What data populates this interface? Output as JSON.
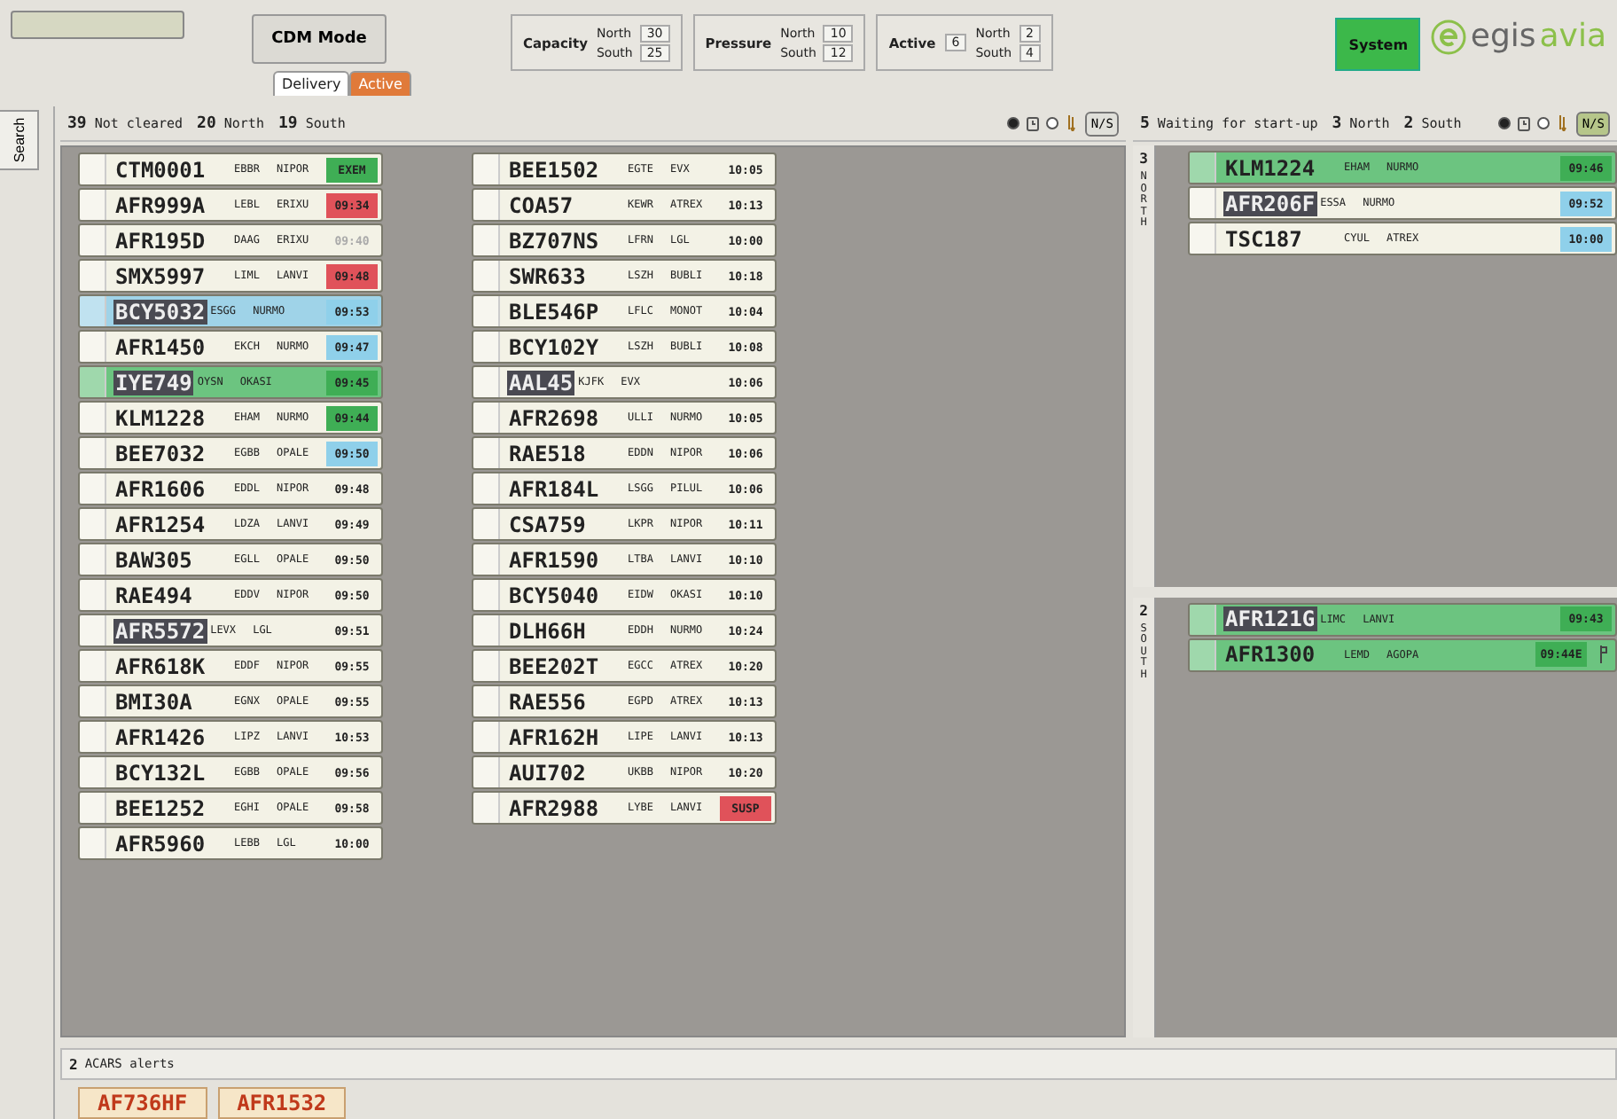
{
  "search_tab": {
    "label": "Search"
  },
  "top": {
    "mode_button": "CDM Mode",
    "tabs": [
      {
        "label": "Delivery",
        "selected": true
      },
      {
        "label": "Active",
        "selected": false
      }
    ],
    "gauges": [
      {
        "label": "Capacity",
        "north_label": "North",
        "north": "30",
        "south_label": "South",
        "south": "25"
      },
      {
        "label": "Pressure",
        "north_label": "North",
        "north": "10",
        "south_label": "South",
        "south": "12"
      },
      {
        "label": "Active",
        "total": "6",
        "north_label": "North",
        "north": "2",
        "south_label": "South",
        "south": "4"
      }
    ],
    "system_button": "System",
    "logo": {
      "name": "egis",
      "suffix": "avia"
    }
  },
  "left_panel": {
    "counts": [
      "**39** Not cleared",
      "**20** North",
      "**19** South"
    ],
    "sort_options": [
      {
        "kind": "time",
        "selected": true
      },
      {
        "kind": "order",
        "selected": false
      }
    ],
    "ns_button": {
      "label": "N/S",
      "on": false
    },
    "columns": [
      [
        {
          "callsign": "CTM0001",
          "adep": "EBBR",
          "point": "NIPOR",
          "time": {
            "text": "EXEM",
            "color": "#3fae55",
            "dimmed": false
          },
          "color": "#f3f2e6",
          "selected": false
        },
        {
          "callsign": "AFR999A",
          "adep": "LEBL",
          "point": "ERIXU",
          "time": {
            "text": "09:34",
            "color": "#e0525a",
            "dimmed": false
          },
          "color": "#f3f2e6",
          "selected": false
        },
        {
          "callsign": "AFR195D",
          "adep": "DAAG",
          "point": "ERIXU",
          "time": {
            "text": "09:40",
            "dimmed": true
          },
          "color": "#f3f2e6",
          "selected": false
        },
        {
          "callsign": "SMX5997",
          "adep": "LIML",
          "point": "LANVI",
          "time": {
            "text": "09:48",
            "color": "#e0525a",
            "dimmed": false
          },
          "color": "#f3f2e6",
          "selected": false
        },
        {
          "callsign": "BCY5032",
          "adep": "ESGG",
          "point": "NURMO",
          "time": {
            "text": "09:53",
            "color": "#8fd0ea",
            "dimmed": false
          },
          "color": "#9fd3e8",
          "selected": true
        },
        {
          "callsign": "AFR1450",
          "adep": "EKCH",
          "point": "NURMO",
          "time": {
            "text": "09:47",
            "color": "#8fd0ea",
            "dimmed": false
          },
          "color": "#f3f2e6",
          "selected": false
        },
        {
          "callsign": "IYE749",
          "adep": "OYSN",
          "point": "OKASI",
          "time": {
            "text": "09:45",
            "color": "#3fae55",
            "dimmed": false
          },
          "color": "#6cc480",
          "selected": true
        },
        {
          "callsign": "KLM1228",
          "adep": "EHAM",
          "point": "NURMO",
          "time": {
            "text": "09:44",
            "color": "#3fae55",
            "dimmed": false
          },
          "color": "#f3f2e6",
          "selected": false
        },
        {
          "callsign": "BEE7032",
          "adep": "EGBB",
          "point": "OPALE",
          "time": {
            "text": "09:50",
            "color": "#8fd0ea",
            "dimmed": false
          },
          "color": "#f3f2e6",
          "selected": false
        },
        {
          "callsign": "AFR1606",
          "adep": "EDDL",
          "point": "NIPOR",
          "time": {
            "text": "09:48",
            "dimmed": false
          },
          "color": "#f3f2e6",
          "selected": false
        },
        {
          "callsign": "AFR1254",
          "adep": "LDZA",
          "point": "LANVI",
          "time": {
            "text": "09:49",
            "dimmed": false
          },
          "color": "#f3f2e6",
          "selected": false
        },
        {
          "callsign": "BAW305",
          "adep": "EGLL",
          "point": "OPALE",
          "time": {
            "text": "09:50",
            "dimmed": false
          },
          "color": "#f3f2e6",
          "selected": false
        },
        {
          "callsign": "RAE494",
          "adep": "EDDV",
          "point": "NIPOR",
          "time": {
            "text": "09:50",
            "dimmed": false
          },
          "color": "#f3f2e6",
          "selected": false
        },
        {
          "callsign": "AFR5572",
          "adep": "LEVX",
          "point": "LGL",
          "time": {
            "text": "09:51",
            "dimmed": false
          },
          "color": "#f3f2e6",
          "selected": true
        },
        {
          "callsign": "AFR618K",
          "adep": "EDDF",
          "point": "NIPOR",
          "time": {
            "text": "09:55",
            "dimmed": false
          },
          "color": "#f3f2e6",
          "selected": false
        },
        {
          "callsign": "BMI30A",
          "adep": "EGNX",
          "point": "OPALE",
          "time": {
            "text": "09:55",
            "dimmed": false
          },
          "color": "#f3f2e6",
          "selected": false
        },
        {
          "callsign": "AFR1426",
          "adep": "LIPZ",
          "point": "LANVI",
          "time": {
            "text": "10:53",
            "dimmed": false
          },
          "color": "#f3f2e6",
          "selected": false
        },
        {
          "callsign": "BCY132L",
          "adep": "EGBB",
          "point": "OPALE",
          "time": {
            "text": "09:56",
            "dimmed": false
          },
          "color": "#f3f2e6",
          "selected": false
        },
        {
          "callsign": "BEE1252",
          "adep": "EGHI",
          "point": "OPALE",
          "time": {
            "text": "09:58",
            "dimmed": false
          },
          "color": "#f3f2e6",
          "selected": false
        },
        {
          "callsign": "AFR5960",
          "adep": "LEBB",
          "point": "LGL",
          "time": {
            "text": "10:00",
            "dimmed": false
          },
          "color": "#f3f2e6",
          "selected": false
        }
      ],
      [
        {
          "callsign": "BEE1502",
          "adep": "EGTE",
          "point": "EVX",
          "time": {
            "text": "10:05",
            "dimmed": false
          },
          "color": "#f3f2e6",
          "selected": false
        },
        {
          "callsign": "COA57",
          "adep": "KEWR",
          "point": "ATREX",
          "time": {
            "text": "10:13",
            "dimmed": false
          },
          "color": "#f3f2e6",
          "selected": false
        },
        {
          "callsign": "BZ707NS",
          "adep": "LFRN",
          "point": "LGL",
          "time": {
            "text": "10:00",
            "dimmed": false
          },
          "color": "#f3f2e6",
          "selected": false
        },
        {
          "callsign": "SWR633",
          "adep": "LSZH",
          "point": "BUBLI",
          "time": {
            "text": "10:18",
            "dimmed": false
          },
          "color": "#f3f2e6",
          "selected": false
        },
        {
          "callsign": "BLE546P",
          "adep": "LFLC",
          "point": "MONOT",
          "time": {
            "text": "10:04",
            "dimmed": false
          },
          "color": "#f3f2e6",
          "selected": false
        },
        {
          "callsign": "BCY102Y",
          "adep": "LSZH",
          "point": "BUBLI",
          "time": {
            "text": "10:08",
            "dimmed": false
          },
          "color": "#f3f2e6",
          "selected": false
        },
        {
          "callsign": "AAL45",
          "adep": "KJFK",
          "point": "EVX",
          "time": {
            "text": "10:06",
            "dimmed": false
          },
          "color": "#f3f2e6",
          "selected": true
        },
        {
          "callsign": "AFR2698",
          "adep": "ULLI",
          "point": "NURMO",
          "time": {
            "text": "10:05",
            "dimmed": false
          },
          "color": "#f3f2e6",
          "selected": false
        },
        {
          "callsign": "RAE518",
          "adep": "EDDN",
          "point": "NIPOR",
          "time": {
            "text": "10:06",
            "dimmed": false
          },
          "color": "#f3f2e6",
          "selected": false
        },
        {
          "callsign": "AFR184L",
          "adep": "LSGG",
          "point": "PILUL",
          "time": {
            "text": "10:06",
            "dimmed": false
          },
          "color": "#f3f2e6",
          "selected": false
        },
        {
          "callsign": "CSA759",
          "adep": "LKPR",
          "point": "NIPOR",
          "time": {
            "text": "10:11",
            "dimmed": false
          },
          "color": "#f3f2e6",
          "selected": false
        },
        {
          "callsign": "AFR1590",
          "adep": "LTBA",
          "point": "LANVI",
          "time": {
            "text": "10:10",
            "dimmed": false
          },
          "color": "#f3f2e6",
          "selected": false
        },
        {
          "callsign": "BCY5040",
          "adep": "EIDW",
          "point": "OKASI",
          "time": {
            "text": "10:10",
            "dimmed": false
          },
          "color": "#f3f2e6",
          "selected": false
        },
        {
          "callsign": "DLH66H",
          "adep": "EDDH",
          "point": "NURMO",
          "time": {
            "text": "10:24",
            "dimmed": false
          },
          "color": "#f3f2e6",
          "selected": false
        },
        {
          "callsign": "BEE202T",
          "adep": "EGCC",
          "point": "ATREX",
          "time": {
            "text": "10:20",
            "dimmed": false
          },
          "color": "#f3f2e6",
          "selected": false
        },
        {
          "callsign": "RAE556",
          "adep": "EGPD",
          "point": "ATREX",
          "time": {
            "text": "10:13",
            "dimmed": false
          },
          "color": "#f3f2e6",
          "selected": false
        },
        {
          "callsign": "AFR162H",
          "adep": "LIPE",
          "point": "LANVI",
          "time": {
            "text": "10:13",
            "dimmed": false
          },
          "color": "#f3f2e6",
          "selected": false
        },
        {
          "callsign": "AUI702",
          "adep": "UKBB",
          "point": "NIPOR",
          "time": {
            "text": "10:20",
            "dimmed": false
          },
          "color": "#f3f2e6",
          "selected": false
        },
        {
          "callsign": "AFR2988",
          "adep": "LYBE",
          "point": "LANVI",
          "time": {
            "text": "SUSP",
            "color": "#e0525a",
            "dimmed": false
          },
          "color": "#f3f2e6",
          "selected": false
        }
      ]
    ]
  },
  "right_panel": {
    "counts": [
      "**5** Waiting for start-up",
      "**3** North",
      "**2** South"
    ],
    "sort_options": [
      {
        "kind": "time",
        "selected": true
      },
      {
        "kind": "order",
        "selected": false
      }
    ],
    "ns_button": {
      "label": "N/S",
      "on": true
    },
    "sections": [
      {
        "count": "3",
        "label": "NORTH",
        "strips": [
          {
            "callsign": "KLM1224",
            "adep": "EHAM",
            "point": "NURMO",
            "time": {
              "text": "09:46",
              "color": "#3fae55",
              "dimmed": false
            },
            "color": "#6cc480",
            "selected": false,
            "flag": false
          },
          {
            "callsign": "AFR206F",
            "adep": "ESSA",
            "point": "NURMO",
            "time": {
              "text": "09:52",
              "color": "#8fd0ea",
              "dimmed": false
            },
            "color": "#f3f2e6",
            "selected": true,
            "flag": false
          },
          {
            "callsign": "TSC187",
            "adep": "CYUL",
            "point": "ATREX",
            "time": {
              "text": "10:00",
              "color": "#8fd0ea",
              "dimmed": false
            },
            "color": "#f3f2e6",
            "selected": false,
            "flag": false
          }
        ]
      },
      {
        "count": "2",
        "label": "SOUTH",
        "strips": [
          {
            "callsign": "AFR121G",
            "adep": "LIMC",
            "point": "LANVI",
            "time": {
              "text": "09:43",
              "color": "#3fae55",
              "dimmed": false
            },
            "color": "#6cc480",
            "selected": true,
            "flag": false
          },
          {
            "callsign": "AFR1300",
            "adep": "LEMD",
            "point": "AGOPA",
            "time": {
              "text": "09:44E",
              "color": "#3fae55",
              "dimmed": false
            },
            "color": "#6cc480",
            "selected": false,
            "flag": true
          }
        ]
      }
    ]
  },
  "acars": {
    "count": "2",
    "label": "ACARS alerts",
    "strips": [
      "AF736HF",
      "AFR1532"
    ]
  }
}
